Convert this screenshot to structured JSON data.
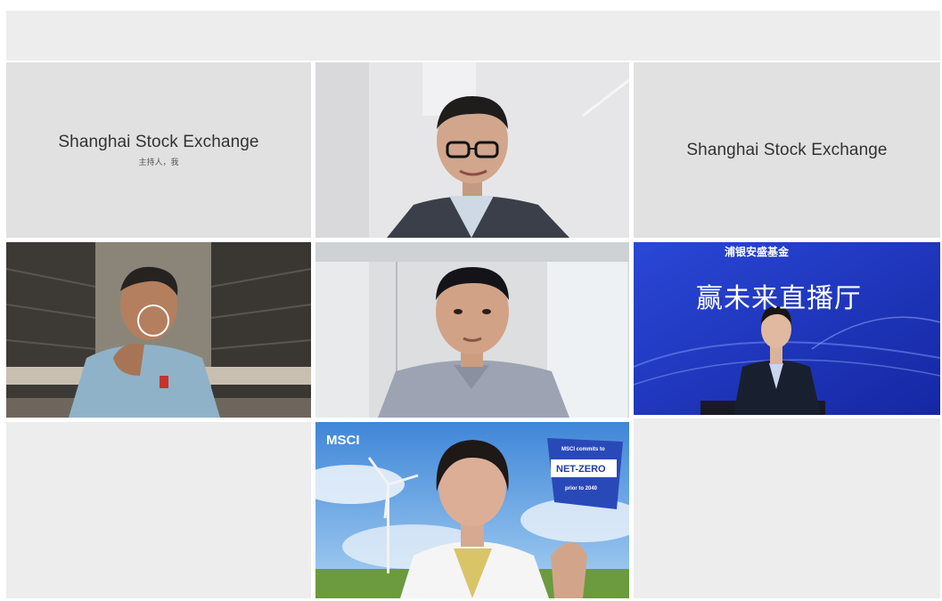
{
  "participants": [
    {
      "name": "Shanghai Stock Exchange",
      "role": "主持人，我"
    },
    {
      "name": "Shanghai Stock Exchange"
    }
  ],
  "overlays": {
    "fund_banner_title": "赢未来直播厅",
    "fund_logo_text": "浦银安盛基金",
    "msci_logo": "MSCI",
    "netzero_line1": "MSCI commits to",
    "netzero_main": "NET-ZERO",
    "netzero_line3": "prior to 2040"
  },
  "colors": {
    "name_tile_bg": "#e1e1e1",
    "background": "#ededed",
    "fund_blue": "#1d35b8"
  }
}
